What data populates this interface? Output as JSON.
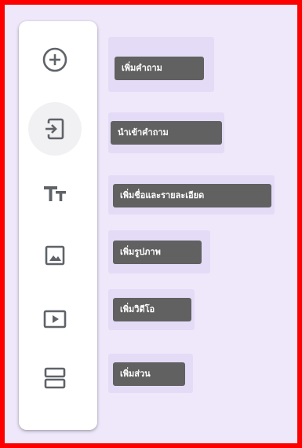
{
  "toolbar": {
    "items": [
      {
        "icon": "add-circle-icon",
        "tooltip": "เพิ่มคำถาม"
      },
      {
        "icon": "import-question-icon",
        "tooltip": "นำเข้าคำถาม"
      },
      {
        "icon": "title-text-icon",
        "tooltip": "เพิ่มชื่อและรายละเอียด"
      },
      {
        "icon": "image-icon",
        "tooltip": "เพิ่มรูปภาพ"
      },
      {
        "icon": "video-icon",
        "tooltip": "เพิ่มวิดีโอ"
      },
      {
        "icon": "section-icon",
        "tooltip": "เพิ่มส่วน"
      }
    ]
  },
  "colors": {
    "border": "#ff0000",
    "background": "#efe8fb",
    "tooltip_bg": "#616161",
    "icon": "#5f6368"
  }
}
